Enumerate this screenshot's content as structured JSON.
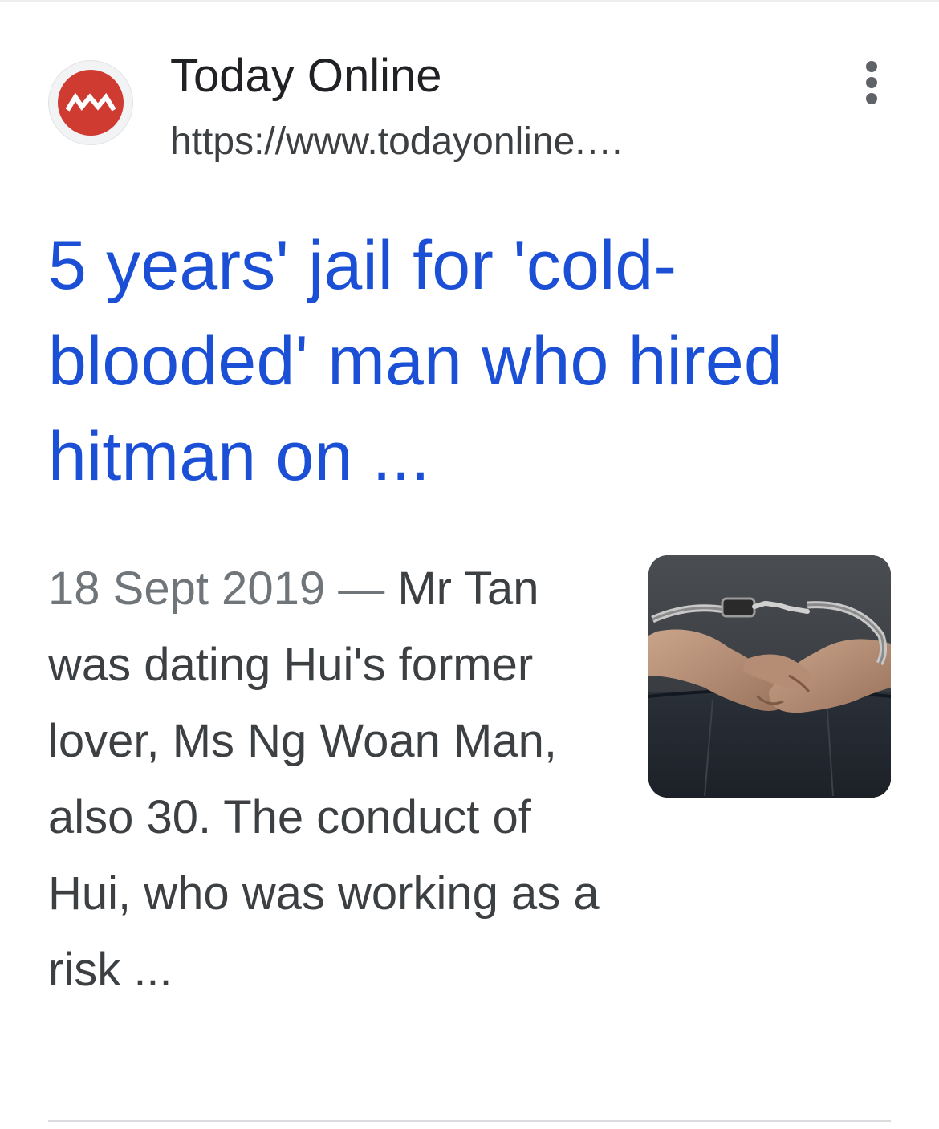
{
  "result": {
    "site_name": "Today Online",
    "site_url": "https://www.todayonline.…",
    "title": "5 years' jail for 'cold-blooded' man who hired hitman on ...",
    "snippet_date": "18 Sept 2019",
    "snippet_separator": " — ",
    "snippet_text": "Mr Tan was dating Hui's former lover, Ms Ng Woan Man, also 30. The conduct of Hui, who was working as a risk ...",
    "thumbnail_icon": "handcuffed-hands-image",
    "favicon_icon": "todayonline-logo-icon",
    "more_icon": "vertical-dots-icon"
  },
  "colors": {
    "title_link": "#1a4fd6",
    "favicon_red": "#cf3a31",
    "text": "#3c4043",
    "muted": "#70757a"
  }
}
